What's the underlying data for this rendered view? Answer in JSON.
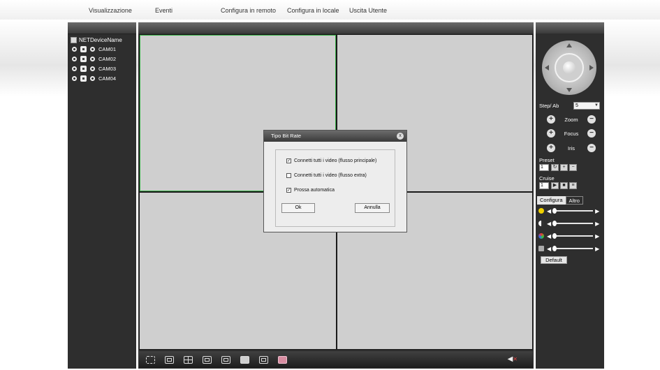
{
  "nav": {
    "items": [
      "Visualizzazione",
      "Eventi",
      "Configura in remoto",
      "Configura in locale",
      "Uscita Utente"
    ]
  },
  "device_tree": {
    "root_label": "NETDeviceName",
    "cameras": [
      "CAM01",
      "CAM02",
      "CAM03",
      "CAM04"
    ]
  },
  "bottom_toolbar": {
    "icons": [
      "fullscreen-icon",
      "single-view-icon",
      "quad-view-icon",
      "nine-view-icon",
      "sixteen-view-icon",
      "capture-icon",
      "record-icon",
      "talk-icon"
    ],
    "volume_icon": "speaker-muted-icon"
  },
  "ptz": {
    "step_label": "Step/ Ab",
    "step_value": "5",
    "zoom_label": "Zoom",
    "focus_label": "Focus",
    "iris_label": "Iris",
    "preset_label": "Preset",
    "preset_value": "1",
    "cruise_label": "Cruise",
    "cruise_value": "1"
  },
  "config_tabs": {
    "tab1": "Configura",
    "tab2": "Altro",
    "default_label": "Default"
  },
  "dialog": {
    "title": "Tipo Bit Rate",
    "close_glyph": "x",
    "options": [
      {
        "label": "Connetti tutti i video (flusso principale)",
        "checked": true
      },
      {
        "label": "Connetti tutti i video (flusso extra)",
        "checked": false
      },
      {
        "label": "Prossa automatica",
        "checked": true
      }
    ],
    "ok_label": "Ok",
    "cancel_label": "Annulla"
  }
}
